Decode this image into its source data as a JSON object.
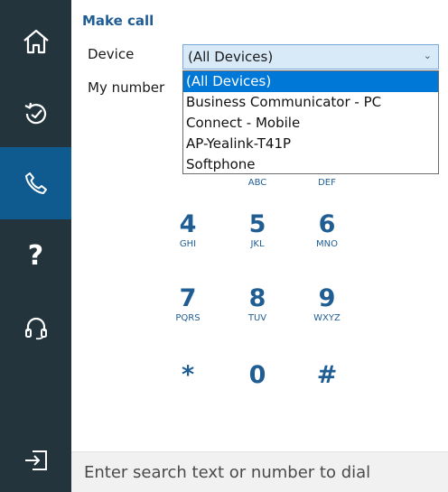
{
  "sidebar": {
    "items": [
      {
        "name": "home",
        "icon": "home-icon"
      },
      {
        "name": "history",
        "icon": "history-icon"
      },
      {
        "name": "call",
        "icon": "phone-icon",
        "active": true
      },
      {
        "name": "help",
        "icon": "help-icon",
        "glyph": "?"
      },
      {
        "name": "headset",
        "icon": "headset-icon"
      },
      {
        "name": "logout",
        "icon": "logout-icon"
      }
    ]
  },
  "make_call": {
    "title": "Make call",
    "device_label": "Device",
    "my_number_label": "My number",
    "device_selected": "(All Devices)",
    "device_options": [
      "(All Devices)",
      "Business Communicator - PC",
      "Connect - Mobile",
      "AP-Yealink-T41P",
      "Softphone"
    ]
  },
  "keypad": {
    "row1_letters": [
      "ABC",
      "DEF"
    ],
    "keys": [
      {
        "digit": "4",
        "letters": "GHI"
      },
      {
        "digit": "5",
        "letters": "JKL"
      },
      {
        "digit": "6",
        "letters": "MNO"
      },
      {
        "digit": "7",
        "letters": "PQRS"
      },
      {
        "digit": "8",
        "letters": "TUV"
      },
      {
        "digit": "9",
        "letters": "WXYZ"
      },
      {
        "digit": "*",
        "letters": ""
      },
      {
        "digit": "0",
        "letters": ""
      },
      {
        "digit": "#",
        "letters": ""
      }
    ]
  },
  "search": {
    "placeholder": "Enter search text or number to dial"
  },
  "colors": {
    "sidebar_bg": "#23343d",
    "sidebar_active": "#0f5a8e",
    "accent": "#1f5d93",
    "selection": "#0078d7"
  }
}
